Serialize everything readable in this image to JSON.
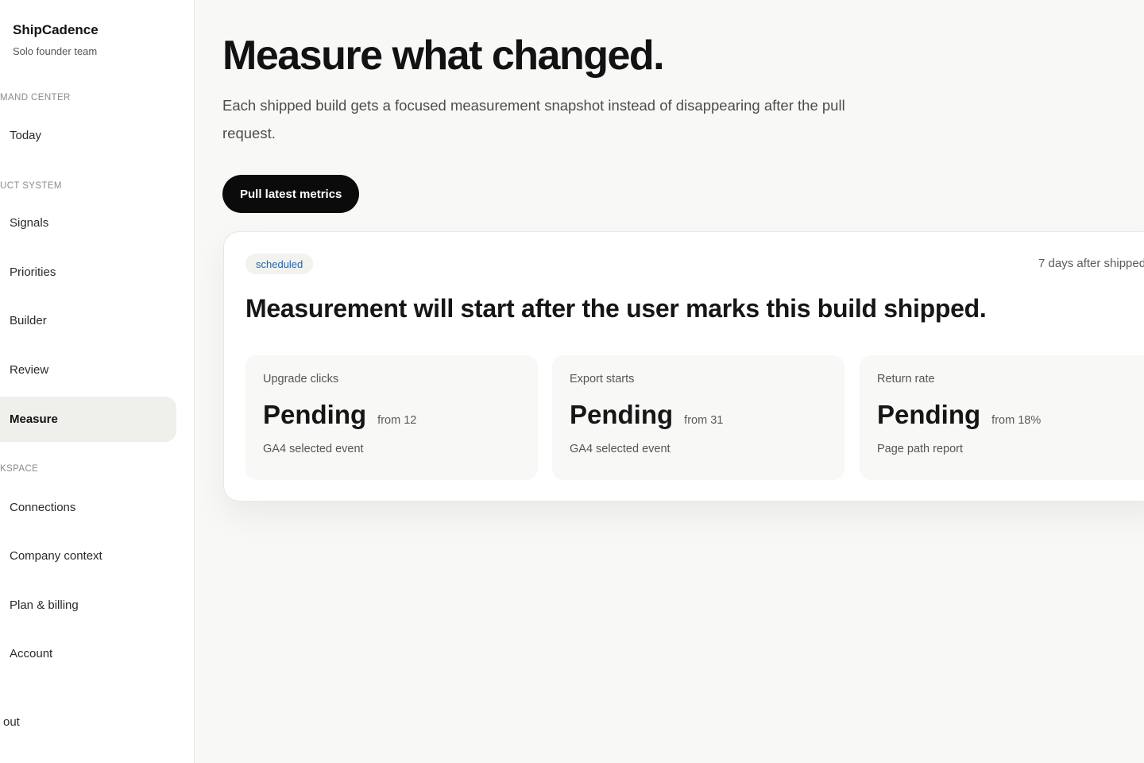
{
  "sidebar": {
    "brand": "ShipCadence",
    "subtitle": "Solo founder team",
    "sections": {
      "command_center": "MAND CENTER",
      "product_system": "UCT SYSTEM",
      "workspace": "KSPACE"
    },
    "items": {
      "today": "Today",
      "signals": "Signals",
      "priorities": "Priorities",
      "builder": "Builder",
      "review": "Review",
      "measure": "Measure",
      "connections": "Connections",
      "company_context": "Company context",
      "plan_billing": "Plan & billing",
      "account": "Account"
    },
    "active_item": "Measure",
    "signout": "out"
  },
  "main": {
    "title": "Measure what changed.",
    "description": "Each shipped build gets a focused measurement snapshot instead of disappearing after the pull request.",
    "pull_button": "Pull latest metrics",
    "card": {
      "status": "scheduled",
      "meta": "7 days after shipped",
      "title": "Measurement will start after the user marks this build shipped.",
      "metrics": [
        {
          "label": "Upgrade clicks",
          "value": "Pending",
          "from": "from 12",
          "source": "GA4 selected event"
        },
        {
          "label": "Export starts",
          "value": "Pending",
          "from": "from 31",
          "source": "GA4 selected event"
        },
        {
          "label": "Return rate",
          "value": "Pending",
          "from": "from 18%",
          "source": "Page path report"
        }
      ]
    }
  },
  "colors": {
    "accent": "#0b0b0b",
    "badge_text": "#2467a8",
    "background": "#f8f8f7",
    "active_nav": "#efefec"
  }
}
